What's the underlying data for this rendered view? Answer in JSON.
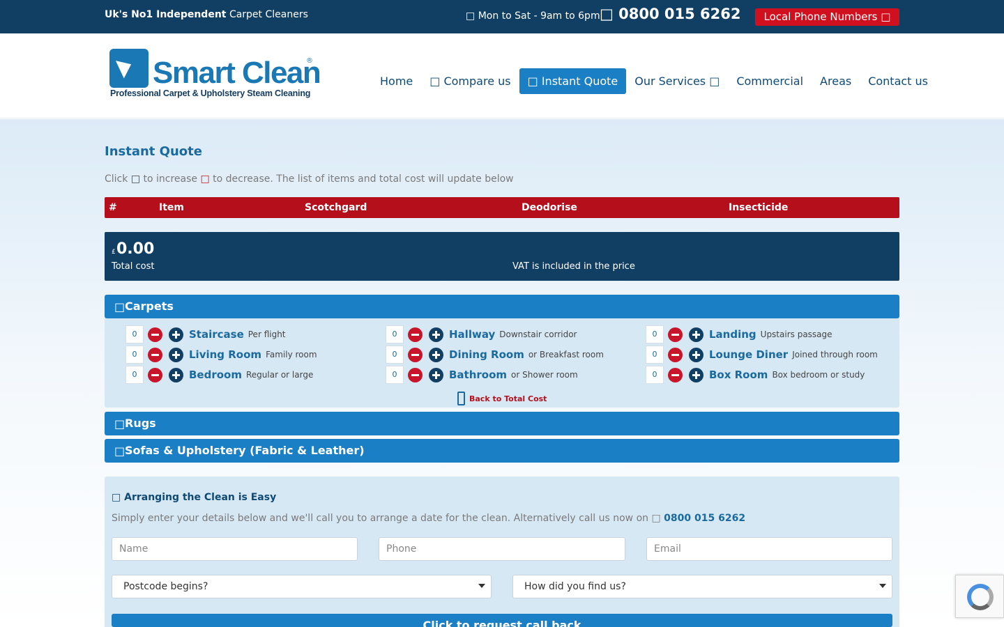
{
  "topbar": {
    "tagline_bold": "Uk's No1 Independent",
    "tagline_rest": "Carpet Cleaners",
    "hours": "Mon to Sat - 9am to 6pm",
    "phone": "0800 015 6262",
    "local_numbers": "Local Phone Numbers",
    "glyph": "□"
  },
  "logo": {
    "name": "Smart Clean",
    "reg": "®",
    "subtitle": "Professional Carpet & Upholstery Steam Cleaning"
  },
  "nav": {
    "home": "Home",
    "compare": "Compare us",
    "quote": "Instant Quote",
    "services": "Our Services",
    "commercial": "Commercial",
    "areas": "Areas",
    "contact": "Contact us"
  },
  "quote": {
    "title": "Instant Quote",
    "instr_click": "Click",
    "instr_increase": "to increase",
    "instr_decrease": "to decrease. The list of items and total cost will update below",
    "columns": [
      "#",
      "Item",
      "Scotchgard",
      "Deodorise",
      "Insecticide"
    ],
    "currency": "£",
    "total": "0.00",
    "total_label": "Total cost",
    "vat": "VAT is included in the price"
  },
  "accordion": {
    "carpets": "Carpets",
    "rugs": "Rugs",
    "sofas": "Sofas & Upholstery (Fabric & Leather)"
  },
  "rooms": [
    {
      "qty": "0",
      "name": "Staircase",
      "desc": "Per flight"
    },
    {
      "qty": "0",
      "name": "Hallway",
      "desc": "Downstair corridor"
    },
    {
      "qty": "0",
      "name": "Landing",
      "desc": "Upstairs passage"
    },
    {
      "qty": "0",
      "name": "Living Room",
      "desc": "Family room"
    },
    {
      "qty": "0",
      "name": "Dining Room",
      "desc": "or Breakfast room"
    },
    {
      "qty": "0",
      "name": "Lounge Diner",
      "desc": "Joined through room"
    },
    {
      "qty": "0",
      "name": "Bedroom",
      "desc": "Regular or large"
    },
    {
      "qty": "0",
      "name": "Bathroom",
      "desc": "or Shower room"
    },
    {
      "qty": "0",
      "name": "Box Room",
      "desc": "Box bedroom or study"
    }
  ],
  "back_link": "Back to Total Cost",
  "arrange": {
    "title": "Arranging the Clean is Easy",
    "text": "Simply enter your details below and we'll call you to arrange a date for the clean. Alternatively call us now on",
    "phone": "0800 015 6262",
    "name_placeholder": "Name",
    "phone_placeholder": "Phone",
    "email_placeholder": "Email",
    "postcode_select": "Postcode begins?",
    "source_select": "How did you find us?",
    "submit": "Click to request call back"
  },
  "colors": {
    "navy": "#113f63",
    "blue": "#1a7fc5",
    "red": "#b50f1c"
  }
}
